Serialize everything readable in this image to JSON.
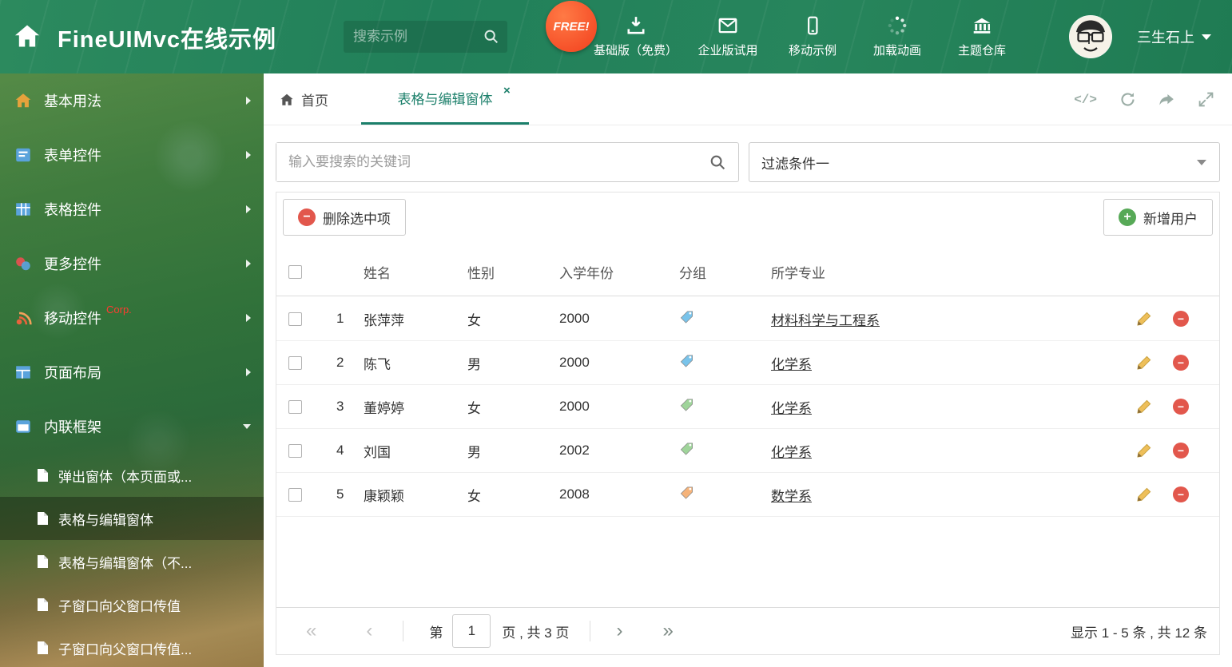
{
  "accent_color": "#1b7f6a",
  "header": {
    "title": "FineUIMvc在线示例",
    "search_placeholder": "搜索示例",
    "free_badge": "FREE!",
    "nav_items": [
      {
        "label": "基础版（免费）"
      },
      {
        "label": "企业版试用"
      },
      {
        "label": "移动示例"
      },
      {
        "label": "加载动画"
      },
      {
        "label": "主题仓库"
      }
    ],
    "username": "三生石上"
  },
  "sidebar": {
    "items": [
      {
        "label": "基本用法"
      },
      {
        "label": "表单控件"
      },
      {
        "label": "表格控件"
      },
      {
        "label": "更多控件"
      },
      {
        "label": "移动控件",
        "badge": "Corp."
      },
      {
        "label": "页面布局"
      },
      {
        "label": "内联框架"
      }
    ],
    "subitems": [
      {
        "label": "弹出窗体（本页面或..."
      },
      {
        "label": "表格与编辑窗体"
      },
      {
        "label": "表格与编辑窗体（不..."
      },
      {
        "label": "子窗口向父窗口传值"
      },
      {
        "label": "子窗口向父窗口传值..."
      }
    ]
  },
  "tabs": {
    "home_label": "首页",
    "active_label": "表格与编辑窗体"
  },
  "filter": {
    "search_placeholder": "输入要搜索的关键词",
    "dropdown_value": "过滤条件一"
  },
  "toolbar": {
    "delete_label": "删除选中项",
    "add_label": "新增用户"
  },
  "table": {
    "columns": {
      "name": "姓名",
      "gender": "性别",
      "year": "入学年份",
      "group": "分组",
      "major": "所学专业"
    },
    "rows": [
      {
        "num": "1",
        "name": "张萍萍",
        "gender": "女",
        "year": "2000",
        "tag_color": "#79c3ea",
        "major": "材料科学与工程系"
      },
      {
        "num": "2",
        "name": "陈飞",
        "gender": "男",
        "year": "2000",
        "tag_color": "#79c3ea",
        "major": "化学系"
      },
      {
        "num": "3",
        "name": "董婷婷",
        "gender": "女",
        "year": "2000",
        "tag_color": "#9fd49a",
        "major": "化学系"
      },
      {
        "num": "4",
        "name": "刘国",
        "gender": "男",
        "year": "2002",
        "tag_color": "#9fd49a",
        "major": "化学系"
      },
      {
        "num": "5",
        "name": "康颖颖",
        "gender": "女",
        "year": "2008",
        "tag_color": "#f5b37a",
        "major": "数学系"
      }
    ]
  },
  "pagination": {
    "prefix": "第",
    "page_value": "1",
    "suffix": "页 , 共 3 页",
    "summary": "显示 1 - 5 条 , 共 12 条"
  },
  "icons": {
    "code": "</>",
    "close_tab": "×",
    "first": "«",
    "prev": "‹",
    "next": "›",
    "last": "»",
    "minus": "−",
    "plus": "+"
  }
}
